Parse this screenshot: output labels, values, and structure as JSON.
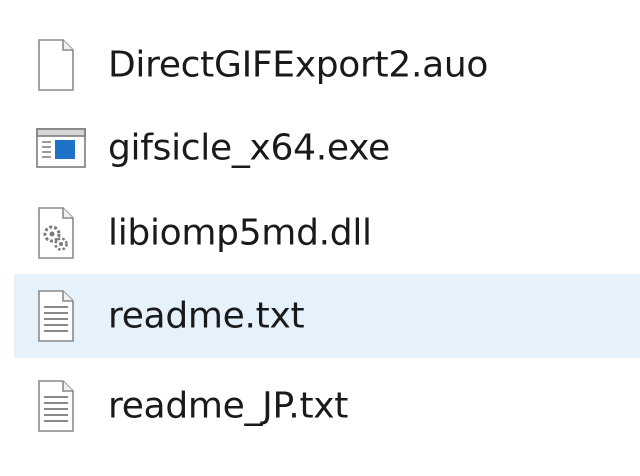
{
  "file_list": {
    "items": [
      {
        "name": "DirectGIFExport2.auo",
        "icon": "blank-file-icon",
        "selected": false
      },
      {
        "name": "gifsicle_x64.exe",
        "icon": "application-window-icon",
        "selected": false
      },
      {
        "name": "libiomp5md.dll",
        "icon": "dll-gears-file-icon",
        "selected": false
      },
      {
        "name": "readme.txt",
        "icon": "text-file-icon",
        "selected": true
      },
      {
        "name": "readme_JP.txt",
        "icon": "text-file-icon",
        "selected": false
      }
    ]
  },
  "colors": {
    "selection_background": "#e5f1fb",
    "text": "#1a1a1a",
    "exe_icon_accent": "#1e73c8"
  }
}
